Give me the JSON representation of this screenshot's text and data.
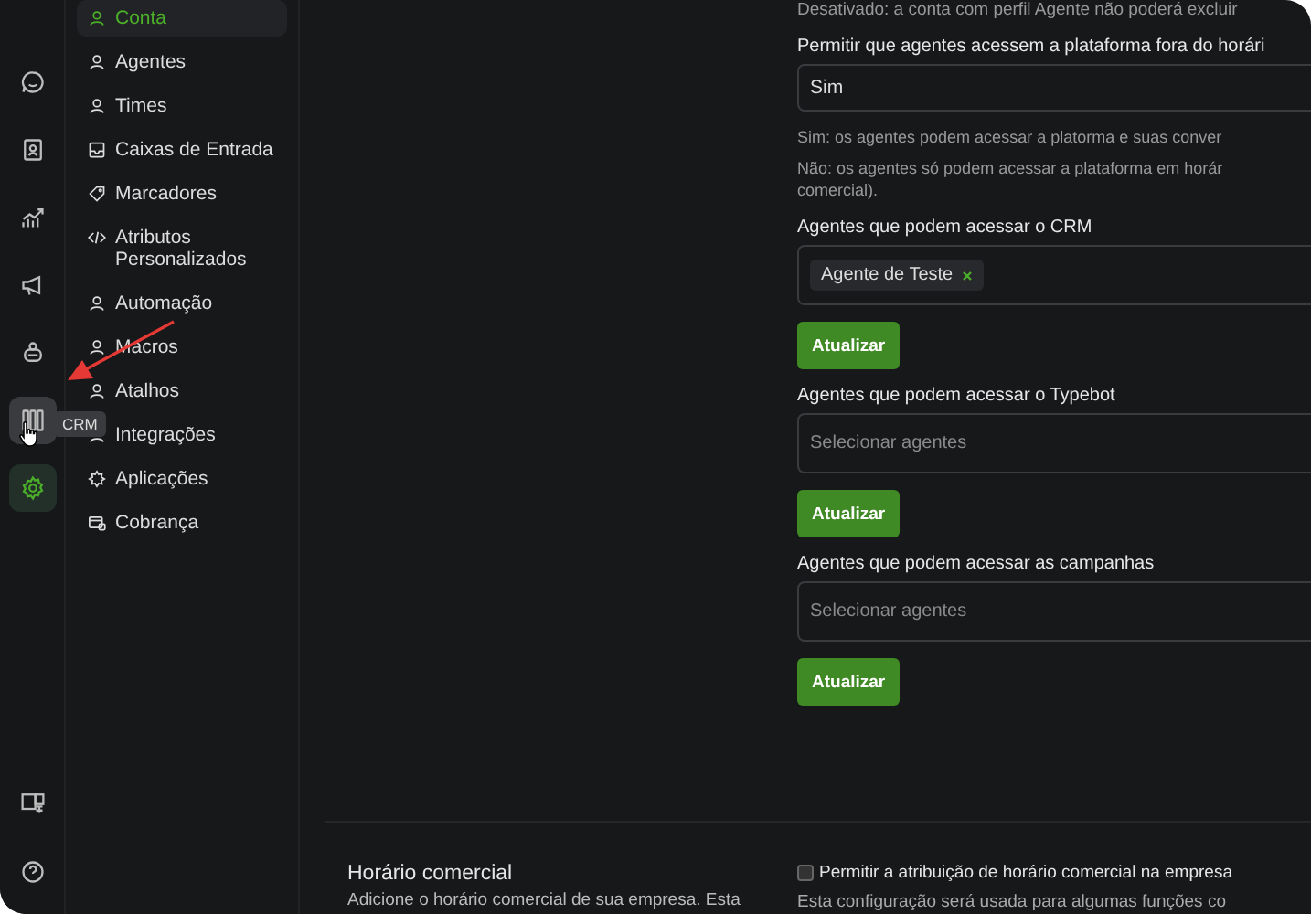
{
  "rail": {
    "items": [
      {
        "selected": false,
        "hovered": false
      },
      {
        "selected": false,
        "hovered": false
      },
      {
        "selected": false,
        "hovered": false
      },
      {
        "selected": false,
        "hovered": false
      },
      {
        "selected": false,
        "hovered": false
      },
      {
        "selected": false,
        "hovered": true
      },
      {
        "selected": true,
        "hovered": false
      }
    ],
    "tooltip": "CRM"
  },
  "nav": {
    "items": [
      {
        "label": "Conta",
        "selected": true
      },
      {
        "label": "Agentes",
        "selected": false
      },
      {
        "label": "Times",
        "selected": false
      },
      {
        "label": "Caixas de Entrada",
        "selected": false
      },
      {
        "label": "Marcadores",
        "selected": false
      },
      {
        "label": "Atributos Personalizados",
        "selected": false
      },
      {
        "label": "Automação",
        "selected": false
      },
      {
        "label": "Macros",
        "selected": false
      },
      {
        "label": "Atalhos",
        "selected": false
      },
      {
        "label": "Integrações",
        "selected": false
      },
      {
        "label": "Aplicações",
        "selected": false
      },
      {
        "label": "Cobrança",
        "selected": false
      }
    ]
  },
  "settings": {
    "top_note": "Desativado: a conta com perfil Agente não poderá excluir",
    "fields": [
      {
        "kind": "select",
        "label": "Permitir que agentes acessem a plataforma fora do horári",
        "value": "Sim",
        "help": [
          "Sim: os agentes podem acessar a platorma e suas conver",
          "Não: os agentes só podem acessar a plataforma em horár comercial)."
        ]
      },
      {
        "kind": "tags",
        "label": "Agentes que podem acessar o CRM",
        "tags": [
          "Agente de Teste"
        ],
        "button": "Atualizar"
      },
      {
        "kind": "tags",
        "label": "Agentes que podem acessar o Typebot",
        "placeholder": "Selecionar agentes",
        "button": "Atualizar"
      },
      {
        "kind": "tags",
        "label": "Agentes que podem acessar as campanhas",
        "placeholder": "Selecionar agentes",
        "button": "Atualizar"
      }
    ]
  },
  "business_hours": {
    "title": "Horário comercial",
    "description": "Adicione o horário comercial de sua empresa. Esta",
    "checkbox": {
      "label": "Permitir a atribuição de horário comercial na empresa",
      "checked": false
    },
    "note": "Esta configuração será usada para algumas funções co"
  }
}
